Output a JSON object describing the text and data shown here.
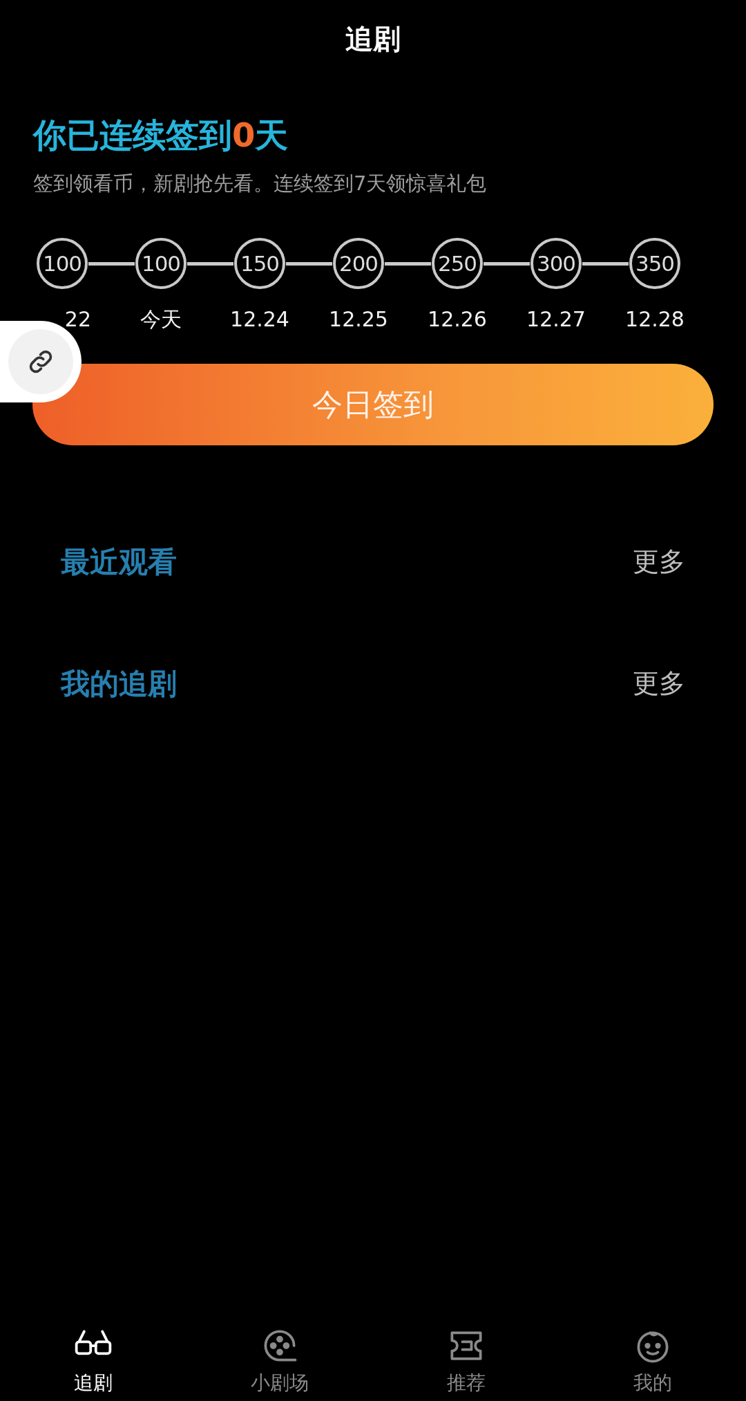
{
  "title": "追剧",
  "checkin": {
    "heading": "你已连续签到**0**天",
    "subtitle": "签到领看币，新剧抢先看。连续签到7天领惊喜礼包",
    "days": [
      {
        "coins": "100",
        "date": "22"
      },
      {
        "coins": "100",
        "date": "今天"
      },
      {
        "coins": "150",
        "date": "12.24"
      },
      {
        "coins": "200",
        "date": "12.25"
      },
      {
        "coins": "250",
        "date": "12.26"
      },
      {
        "coins": "300",
        "date": "12.27"
      },
      {
        "coins": "350",
        "date": "12.28"
      }
    ],
    "button": "今日签到"
  },
  "sections": [
    {
      "title": "最近观看",
      "more": "更多"
    },
    {
      "title": "我的追剧",
      "more": "更多"
    }
  ],
  "tabs": [
    {
      "label": "追剧",
      "selected": true
    },
    {
      "label": "小剧场",
      "selected": false
    },
    {
      "label": "推荐",
      "selected": false
    },
    {
      "label": "我的",
      "selected": false
    }
  ]
}
